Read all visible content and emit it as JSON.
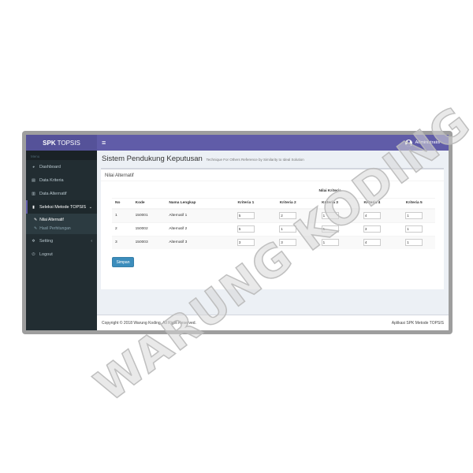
{
  "app": {
    "logo_bold": "SPK",
    "logo_rest": "TOPSIS",
    "toggle_icon": "≡",
    "user": "Administrator"
  },
  "sidebar": {
    "header": "Menu",
    "items": [
      {
        "label": "Dashboard",
        "icon": "dashboard-icon"
      },
      {
        "label": "Data Kriteria",
        "icon": "table-icon"
      },
      {
        "label": "Data Alternatif",
        "icon": "list-icon"
      },
      {
        "label": "Seleksi Metode TOPSIS",
        "icon": "bar-chart-icon"
      }
    ],
    "sub_items": [
      {
        "label": "Nilai Alternatif"
      },
      {
        "label": "Hasil Perhitungan"
      }
    ],
    "setting": "Setting",
    "logout": "Logout"
  },
  "page": {
    "title": "Sistem Pendukung Keputusan",
    "subtitle": "Technique For Others Reference by Similarity to Ideal Solution",
    "box_title": "Nilai Alternatif"
  },
  "table": {
    "group_header": "Nilai Kriteria",
    "headers": [
      "No",
      "Kode",
      "Nama Lengkap",
      "Kriteria 1",
      "Kriteria 2",
      "Kriteria 3",
      "Kriteria 4",
      "Kriteria 5"
    ],
    "rows": [
      {
        "no": "1",
        "kode": "150001",
        "nama": "Alternatif 1",
        "values": [
          "5",
          "2",
          "1",
          "4",
          "1"
        ]
      },
      {
        "no": "2",
        "kode": "150002",
        "nama": "Alternatif 2",
        "values": [
          "5",
          "1",
          "1",
          "3",
          "1"
        ]
      },
      {
        "no": "3",
        "kode": "150003",
        "nama": "Alternatif 3",
        "values": [
          "3",
          "3",
          "1",
          "4",
          "1"
        ]
      }
    ]
  },
  "save_label": "Simpan",
  "footer": {
    "left": "Copyright © 2018 Warung Koding. All Right Reserved.",
    "right": "Aplikasi SPK Metode TOPSIS"
  },
  "watermark": "WARUNG KODING",
  "colors": {
    "topbar": "#605ca8",
    "sidebar": "#222d32",
    "button": "#3c8dbc"
  }
}
